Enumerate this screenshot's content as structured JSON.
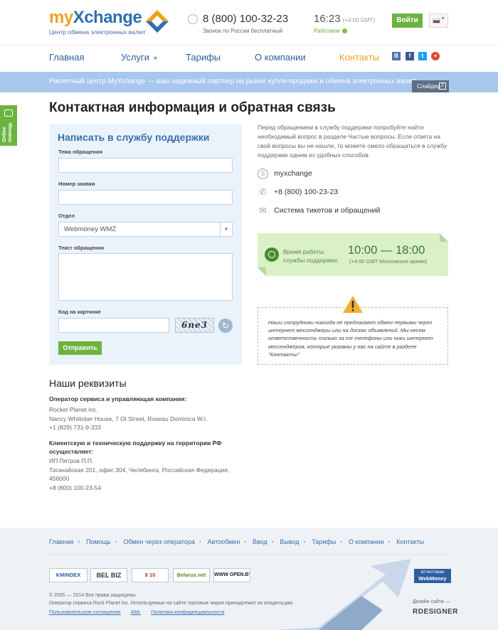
{
  "header": {
    "logo_my": "my",
    "logo_xchange": "Xchange",
    "logo_sub": "Центр обмена электронных валют",
    "phone": "8 (800) 100-32-23",
    "phone_sub": "Звонок по России бесплатный",
    "time": "16:23",
    "time_gmt": "(+4:00 GMT)",
    "work_status": "Работаем",
    "login_label": "Войти",
    "language": "ru"
  },
  "nav": {
    "items": [
      {
        "label": "Главная"
      },
      {
        "label": "Услуги"
      },
      {
        "label": "Тарифы"
      },
      {
        "label": "О компании"
      },
      {
        "label": "Контакты"
      }
    ],
    "social": [
      "B",
      "f",
      "t",
      "+"
    ]
  },
  "banner": {
    "text": "Расчетный центр MyXchange — ваш надежный партнер на рынке купли-продажи и обмена электронных валют.",
    "slider_label": "Слайдер",
    "slider_icon": "2"
  },
  "online_help": {
    "label_line1": "Online",
    "label_line2": "помощь"
  },
  "page": {
    "title": "Контактная информация и обратная связь"
  },
  "form": {
    "title": "Написать в службу поддержки",
    "subject_label": "Тема обращения",
    "order_label": "Номер заявки",
    "department_label": "Отдел",
    "department_value": "Webmoney WMZ",
    "message_label": "Текст обращения",
    "captcha_label": "Код на картинке",
    "captcha_text": "6ne3",
    "submit_label": "Отправить"
  },
  "contacts": {
    "intro": "Перед обращением в службу поддержки попробуйте найти необходимый вопрос в разделе Частые вопросы. Если ответа на свой вопросы вы не нашли, то можете смело обращаться в службу поддержки одним из удобных способов.",
    "skype": "myxchange",
    "phone": "+8 (800) 100-23-23",
    "tickets": "Система тикетов и обращений",
    "hours_label_1": "Время работы",
    "hours_label_2": "службы поддержки:",
    "hours_time": "10:00 — 18:00",
    "hours_gmt": "(+4:00 GMT Московское время)",
    "warning": "Наши сотрудники никогда не предлагают обмен первыми через интернет мессенджеры или на досках объявлений. Мы несем ответственность только за те телефоны или ники интернет мессенджеров, которые указаны у нас на сайте в разделе \"Контакты\""
  },
  "requisites": {
    "title": "Наши реквизиты",
    "op_heading": "Оператор сервиса и управляющая компания:",
    "op_name": "Rocket Planet inc.",
    "op_address": "Nancy Whiticker House, 7 Ol Street, Roseau Dominica W.I.",
    "op_phone": "+1 (829) 731-9-333",
    "support_heading_1": "Клиентскую и техническую поддержку на территории РФ",
    "support_heading_2": "осуществляет:",
    "support_name": "ИП Петров П.П.",
    "support_address_1": "Таганайская 201, офис 304, Челябинск, Российская Федерация,",
    "support_address_2": "456000",
    "support_phone": "+8 (800) 100-23-54"
  },
  "footer": {
    "links": [
      "Главная",
      "Помощь",
      "Обмен через оператора",
      "Автообмен",
      "Ввод",
      "Вывод",
      "Тарифы",
      "О компании",
      "Контакты"
    ],
    "badges": [
      "KMINDEX",
      "BEL BIZ",
      "8 10",
      "Belarus.net",
      "WWW OPEN.BY"
    ],
    "copyright": "© 2005 — 2014 Все права защищены",
    "operator_note": "Оператор сервиса Rock Planet Inc. Используемые на сайте торговые марки принадлежат их владельцам.",
    "policy_links": [
      "Пользовательское соглашение",
      "AML",
      "Политика конфиденциальности"
    ],
    "webmoney_line1": "аттестован",
    "webmoney_line2": "WebMoney",
    "designer_label": "Дизайн сайта —",
    "designer_name": "RDESIGNER"
  }
}
